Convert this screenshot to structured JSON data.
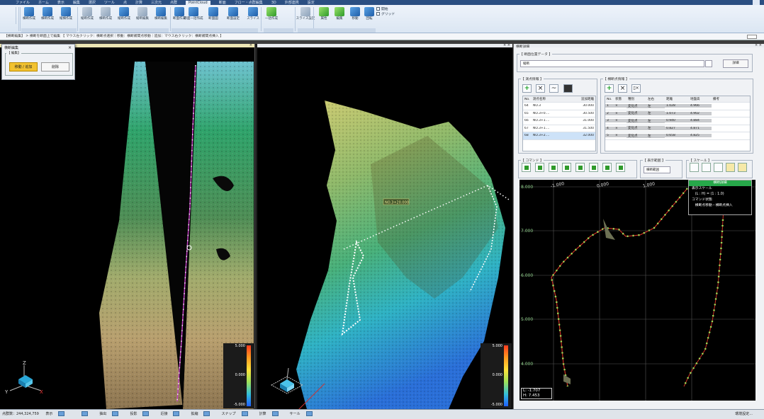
{
  "menubar": {
    "items": [
      "ファイル",
      "ホーム",
      "表示",
      "編集",
      "選択",
      "ツール",
      "点",
      "計算",
      "三次元",
      "点群",
      "PointCloud",
      "断面",
      "フロー・点群編集",
      "3D",
      "外部連携",
      "設定"
    ],
    "active_index": 10
  },
  "ribbon": {
    "buttons": [
      {
        "label": "横断作成",
        "icon": "cross-section-create-icon"
      },
      {
        "label": "横断作成",
        "icon": "cross-section-icon"
      },
      {
        "label": "縦横作成",
        "icon": "vertical-horizontal-icon"
      },
      {
        "label": "縦断作成",
        "icon": "profile-create-icon"
      },
      {
        "label": "横断作成",
        "icon": "cross-create-icon"
      },
      {
        "label": "縦断作成",
        "icon": "longitudinal-create-icon"
      },
      {
        "label": "縦断編集",
        "icon": "profile-edit-icon"
      },
      {
        "label": "横断編集",
        "icon": "cross-edit-icon"
      },
      {
        "label": "断面作成",
        "icon": "section-create-icon"
      },
      {
        "label": "断面一括作成",
        "icon": "section-batch-icon"
      },
      {
        "label": "断面図",
        "icon": "section-view-icon"
      },
      {
        "label": "断面設定",
        "icon": "section-settings-icon"
      },
      {
        "label": "スライス",
        "icon": "slice-icon"
      },
      {
        "label": "一括作成",
        "icon": "batch-create-icon"
      },
      {
        "label": "スライス設定",
        "icon": "slice-settings-icon"
      },
      {
        "label": "属性",
        "icon": "attribute-icon"
      },
      {
        "label": "編集",
        "icon": "edit-icon"
      },
      {
        "label": "移動",
        "icon": "move-icon"
      },
      {
        "label": "回転",
        "icon": "rotate-icon"
      }
    ],
    "checks": [
      "開始",
      "グリッド"
    ]
  },
  "hint": {
    "text": "【横断編集】 > 横断を断面上で編集 【 マウス左クリック：横断点選択｜移動：横断補間点移動｜追加：マウス右クリック：横断補間点挿入 】"
  },
  "dialog": {
    "title": "横断編集",
    "group_label": "【 編集】",
    "primary_button": "移動 / 追加",
    "secondary_button": "削除"
  },
  "view_left": {
    "colorbar": {
      "max": "5.000",
      "mid": "0.000",
      "min": "-5.000"
    },
    "axis_labels": {
      "z": "Z",
      "y": "Y",
      "x": "X"
    }
  },
  "view_mid": {
    "label": "NO.3+20.000",
    "colorbar": {
      "max": "5.000",
      "mid": "0.000",
      "min": "-5.000"
    }
  },
  "panel": {
    "title": "横断詳細",
    "section_data_label": "【 断面位置データ 】",
    "section_data_value": "縦断",
    "detail_button": "詳細",
    "points_label": "【 測点情報 】",
    "points_headers": [
      "No.",
      "測点名称",
      "追加距離"
    ],
    "points_rows": [
      {
        "no": "64",
        "name": "NO.3",
        "dist": "30.000"
      },
      {
        "no": "65",
        "name": "NO.3+0....",
        "dist": "30.500"
      },
      {
        "no": "66",
        "name": "NO.3+1....",
        "dist": "31.000"
      },
      {
        "no": "67",
        "name": "NO.3+1....",
        "dist": "31.500"
      },
      {
        "no": "68",
        "name": "NO.3+2....",
        "dist": "32.000"
      }
    ],
    "cross_label": "【 横断点情報 】",
    "cross_headers": [
      "No.",
      "状態",
      "種別",
      "左右",
      "距離",
      "地盤高",
      "備考"
    ],
    "cross_rows": [
      {
        "no": "1",
        "st": "×",
        "kind": "変化点",
        "lr": "左",
        "dist": "1.028",
        "h": "4.966"
      },
      {
        "no": "2",
        "st": "×",
        "kind": "変化点",
        "lr": "左",
        "dist": "1.073",
        "h": "4.902"
      },
      {
        "no": "3",
        "st": "×",
        "kind": "変化点",
        "lr": "左",
        "dist": "0.940",
        "h": "4.884"
      },
      {
        "no": "4",
        "st": "×",
        "kind": "変化点",
        "lr": "左",
        "dist": "0.827",
        "h": "4.871"
      },
      {
        "no": "5",
        "st": "×",
        "kind": "変化点",
        "lr": "左",
        "dist": "0.658",
        "h": "4.825"
      }
    ],
    "command_label": "【 コマンド 】",
    "display_label": "【 表示範囲 】",
    "display_value": "横断範囲",
    "scale_label": "【 スケール 】",
    "graph": {
      "y_labels": [
        "8.000",
        "7.000",
        "6.000",
        "5.000",
        "4.000"
      ],
      "x_labels": [
        "-1.000",
        "0.000",
        "1.000"
      ],
      "legend_title": "横断詳細",
      "legend_lines": [
        "表示スケール",
        "　(L : H) = (1 : 1.0)",
        "コマンド状態",
        "　横断点移動・横断点挿入"
      ],
      "readout_l": "L: -1.707",
      "readout_h": "H:  7.453"
    }
  },
  "statusbar": {
    "points_text": "点群数：244,324,759",
    "items": [
      "表示",
      "",
      "抽出",
      "投影",
      "近接",
      "拡縮",
      "スナップ",
      "計算",
      "サール"
    ],
    "right_text": "環境設定..."
  }
}
